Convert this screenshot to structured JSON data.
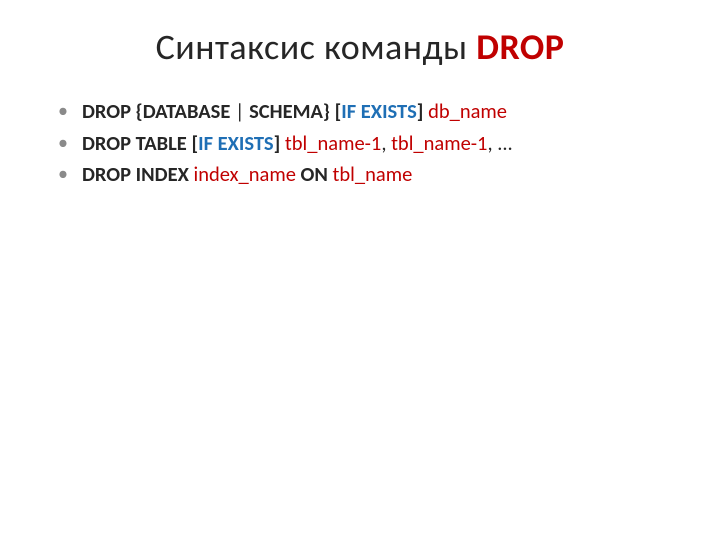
{
  "title": {
    "prefix": "Синтаксис команды ",
    "keyword": "DROP"
  },
  "lines": {
    "l0": {
      "drop": "DROP",
      "braceL": " {",
      "db": "DATABASE",
      "pipe": " | ",
      "schema": "SCHEMA",
      "braceR": "} ",
      "bracketL": "[",
      "ifexists": "IF EXISTS",
      "bracketR": "]",
      "sp": " ",
      "name": "db_name"
    },
    "l1": {
      "droptable": "DROP TABLE",
      "sp1": " ",
      "bracketL": "[",
      "ifexists": "IF EXISTS",
      "bracketR": "]",
      "sp2": " ",
      "n1": "tbl_name-1",
      "c1": ", ",
      "n2": "tbl_name-1",
      "c2": ", ",
      "dots": "..."
    },
    "l2": {
      "dropindex": "DROP INDEX",
      "sp1": " ",
      "idx": "index_name",
      "sp2": " ",
      "on": "ON",
      "sp3": " ",
      "tbl": "tbl_name"
    }
  }
}
